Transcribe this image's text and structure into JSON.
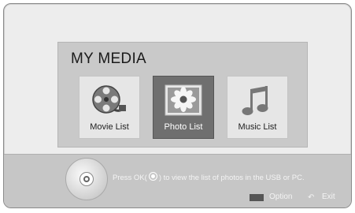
{
  "screen": {
    "title": "MY MEDIA",
    "tiles": [
      {
        "label": "Movie List",
        "icon": "film-reel-icon",
        "selected": false
      },
      {
        "label": "Photo List",
        "icon": "photo-icon",
        "selected": true
      },
      {
        "label": "Music List",
        "icon": "music-note-icon",
        "selected": false
      }
    ]
  },
  "footer": {
    "help_before": "Press OK(",
    "help_after": ") to view the list of photos in the USB or PC.",
    "option_label": "Option",
    "exit_label": "Exit"
  },
  "colors": {
    "panel": "#c9c9c9",
    "selected_tile": "#6f6f6f",
    "bar": "#c6c6c6"
  }
}
